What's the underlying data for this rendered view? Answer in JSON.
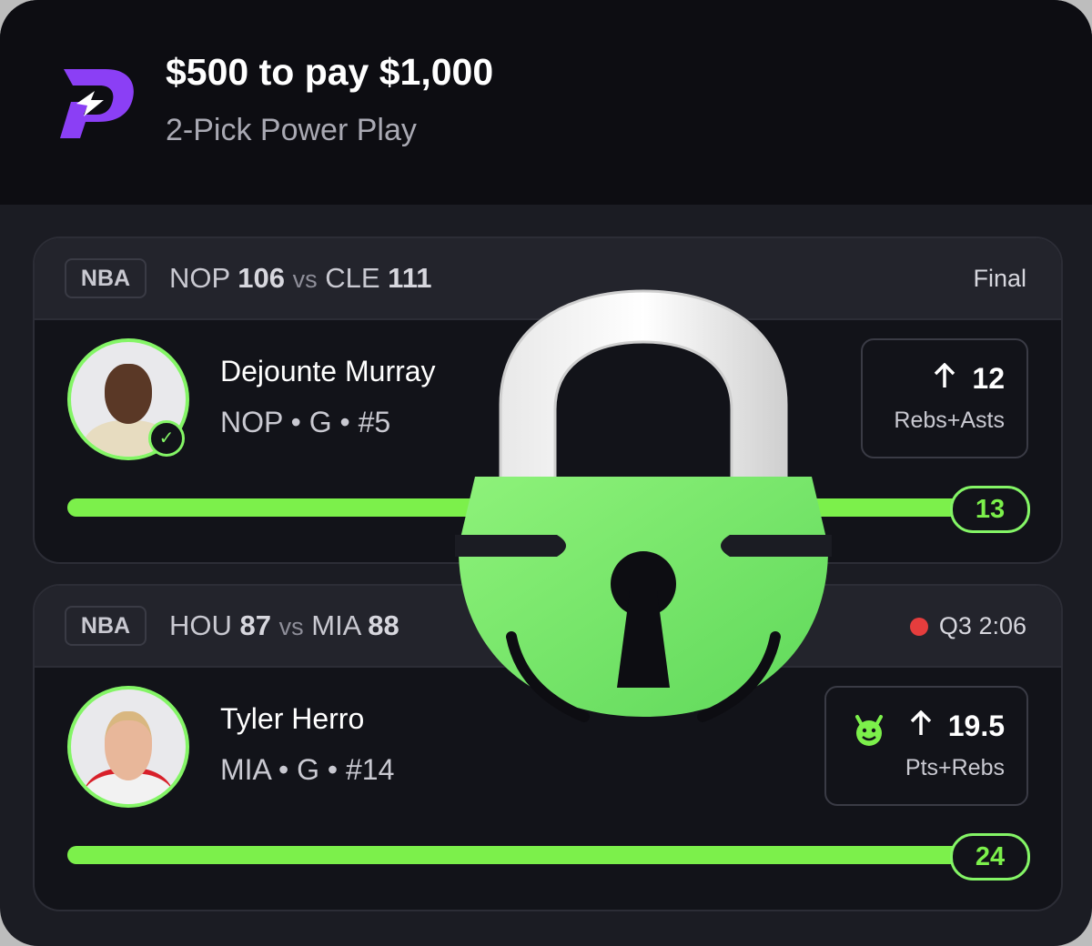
{
  "header": {
    "logo_icon": "prizepicks-logo-icon",
    "title": "$500 to pay $1,000",
    "subtitle": "2-Pick Power Play"
  },
  "cards": [
    {
      "league": "NBA",
      "team1": "NOP",
      "score1": "106",
      "vs": "vs",
      "team2": "CLE",
      "score2": "111",
      "status": "Final",
      "live": false,
      "player": {
        "name": "Dejounte Murray",
        "meta": "NOP • G • #5"
      },
      "pick": {
        "line": "12",
        "stat": "Rebs+Asts",
        "direction_icon": "arrow-up-icon"
      },
      "result": "13",
      "progress": 1.0
    },
    {
      "league": "NBA",
      "team1": "HOU",
      "score1": "87",
      "vs": "vs",
      "team2": "MIA",
      "score2": "88",
      "status": "Q3 2:06",
      "live": true,
      "player": {
        "name": "Tyler Herro",
        "meta": "MIA • G • #14"
      },
      "pick": {
        "line": "19.5",
        "stat": "Pts+Rebs",
        "direction_icon": "arrow-up-icon",
        "badge_icon": "demon-icon"
      },
      "result": "24",
      "progress": 1.0
    }
  ],
  "overlay": {
    "icon": "padlock-icon"
  },
  "colors": {
    "accent_green": "#7cf04b",
    "logo_purple": "#8b3ff5",
    "live_red": "#e53d3d",
    "background": "#1b1c23"
  }
}
